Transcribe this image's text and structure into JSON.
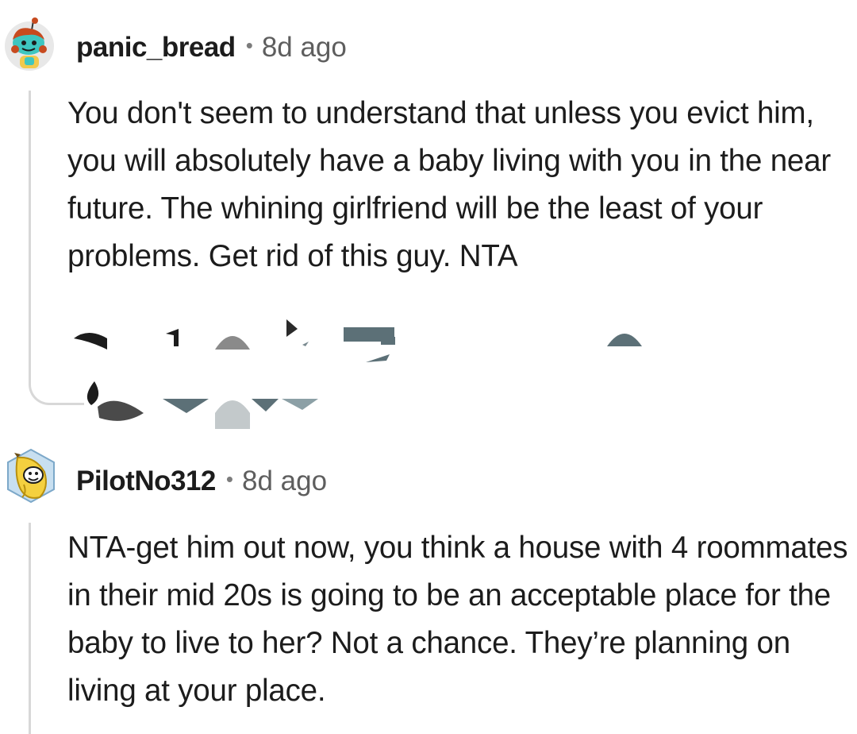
{
  "comments": [
    {
      "username": "panic_bread",
      "separator": "•",
      "timestamp": "8d ago",
      "avatar_icon": "reddit-snoo-avatar-icon",
      "body": "You don't seem to understand that unless you evict him, you will absolutely have a baby living with you in the near future. The whining girlfriend will be the least of your problems. Get rid of this guy. NTA"
    },
    {
      "username": "PilotNo312",
      "separator": "•",
      "timestamp": "8d ago",
      "avatar_icon": "reddit-banana-avatar-icon",
      "body": "NTA-get him out now, you think a house with 4 roommates in their mid 20s is going to be an acceptable place for the baby to live to her? Not a chance. They’re planning on living at your place."
    }
  ],
  "colors": {
    "text": "#1c1c1c",
    "meta": "#5e5e5e",
    "thread": "#d8d8d8",
    "background": "#ffffff"
  }
}
